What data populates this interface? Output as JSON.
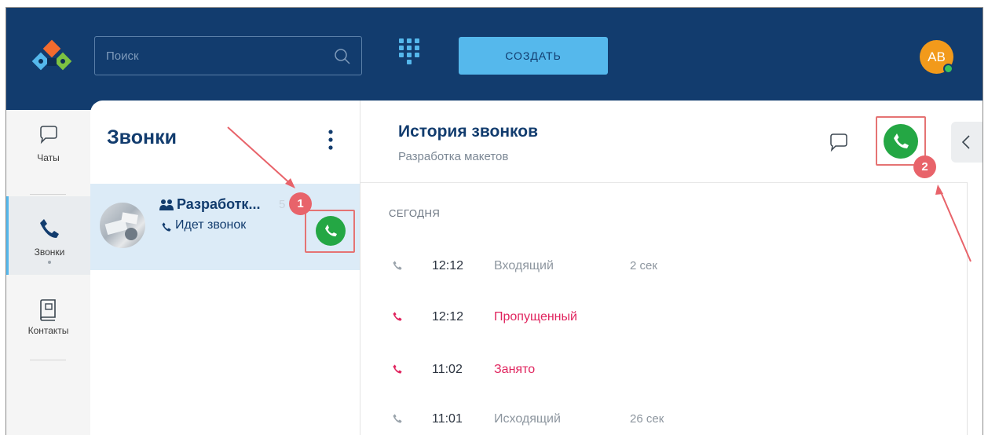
{
  "search": {
    "placeholder": "Поиск"
  },
  "toolbar": {
    "create_label": "СОЗДАТЬ"
  },
  "user": {
    "initials": "AB"
  },
  "nav": {
    "items": [
      {
        "label": "Чаты"
      },
      {
        "label": "Звонки"
      },
      {
        "label": "Контакты"
      }
    ]
  },
  "calls_panel": {
    "title": "Звонки",
    "item": {
      "name": "Разработк...",
      "count": "5",
      "status": "Идет звонок"
    }
  },
  "history": {
    "title": "История звонков",
    "subtitle": "Разработка макетов",
    "section": "СЕГОДНЯ",
    "calls": [
      {
        "time": "12:12",
        "type": "Входящий",
        "duration": "2 сек",
        "missed": false
      },
      {
        "time": "12:12",
        "type": "Пропущенный",
        "duration": "",
        "missed": true
      },
      {
        "time": "11:02",
        "type": "Занято",
        "duration": "",
        "missed": true
      },
      {
        "time": "11:01",
        "type": "Исходящий",
        "duration": "26 сек",
        "missed": false
      }
    ]
  },
  "annotations": {
    "badge_1": "1",
    "badge_2": "2"
  },
  "colors": {
    "header": "#123c6e",
    "accent": "#55b8ec",
    "call_green": "#24a744",
    "missed_red": "#e0245e",
    "annotation_red": "#e8636a"
  }
}
